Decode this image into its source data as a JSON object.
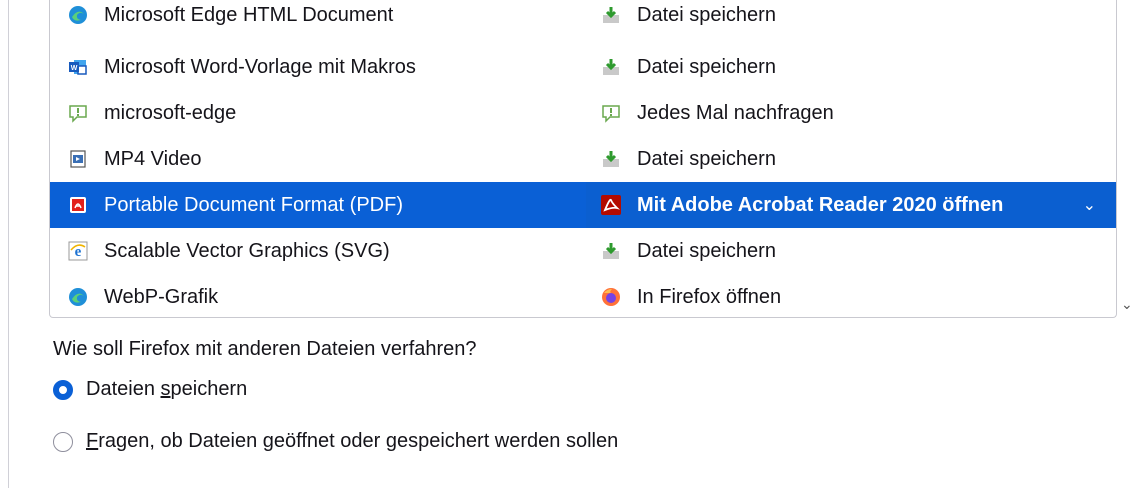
{
  "rows": [
    {
      "type": "Microsoft Edge HTML Document",
      "type_icon": "edge-icon",
      "action": "Datei speichern",
      "action_icon": "save-file-icon"
    },
    {
      "type": "Microsoft Word-Vorlage mit Makros",
      "type_icon": "word-icon",
      "action": "Datei speichern",
      "action_icon": "save-file-icon"
    },
    {
      "type": "microsoft-edge",
      "type_icon": "speech-bubble-icon",
      "action": "Jedes Mal nachfragen",
      "action_icon": "speech-bubble-icon"
    },
    {
      "type": "MP4 Video",
      "type_icon": "video-file-icon",
      "action": "Datei speichern",
      "action_icon": "save-file-icon"
    },
    {
      "type": "Portable Document Format (PDF)",
      "type_icon": "pdf-icon",
      "action": "Mit Adobe Acrobat Reader 2020  öffnen",
      "action_icon": "acrobat-icon",
      "selected": true
    },
    {
      "type": "Scalable Vector Graphics (SVG)",
      "type_icon": "ie-icon",
      "action": "Datei speichern",
      "action_icon": "save-file-icon"
    },
    {
      "type": "WebP-Grafik",
      "type_icon": "edge-icon",
      "action": "In Firefox öffnen",
      "action_icon": "firefox-icon"
    }
  ],
  "other_files": {
    "question": "Wie soll Firefox mit anderen Dateien verfahren?",
    "options": [
      {
        "label_pre": "Dateien ",
        "label_accesskey": "s",
        "label_post": "peichern",
        "checked": true
      },
      {
        "label_pre": "",
        "label_accesskey": "F",
        "label_post": "ragen, ob Dateien geöffnet oder gespeichert werden sollen",
        "checked": false
      }
    ]
  },
  "colors": {
    "selection": "#0a60d6",
    "text": "#15141a"
  }
}
